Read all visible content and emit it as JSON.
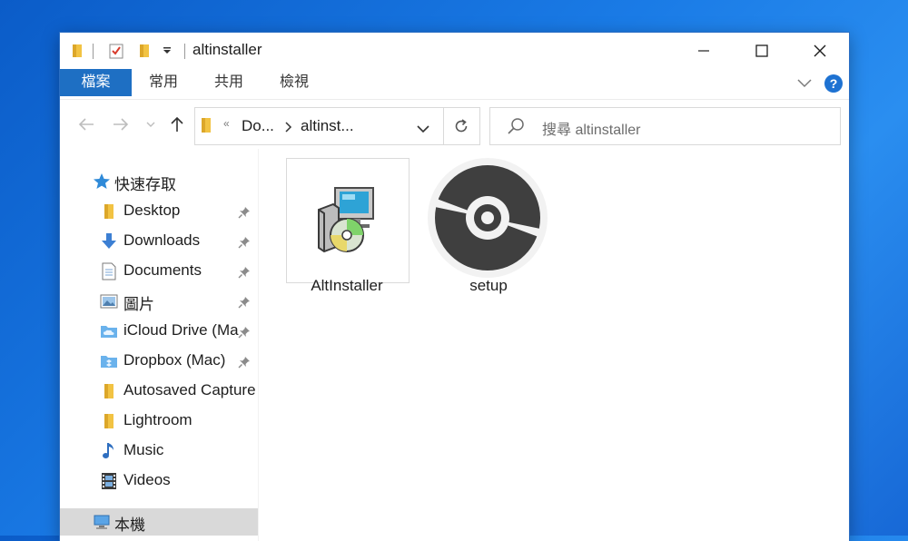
{
  "window": {
    "title": "altinstaller",
    "controls": {
      "minimize": "minimize",
      "maximize": "maximize",
      "close": "close"
    }
  },
  "ribbon": {
    "tabs": [
      {
        "label": "檔案",
        "active": true
      },
      {
        "label": "常用",
        "active": false
      },
      {
        "label": "共用",
        "active": false
      },
      {
        "label": "檢視",
        "active": false
      }
    ],
    "help_label": "?"
  },
  "address_bar": {
    "overflow": "«",
    "crumbs": [
      "Do...",
      "altinst..."
    ],
    "search_placeholder": "搜尋 altinstaller"
  },
  "nav_pane": {
    "quick_access_label": "快速存取",
    "items": [
      {
        "label": "Desktop",
        "icon": "folder-icon",
        "pinned": true
      },
      {
        "label": "Downloads",
        "icon": "download-arrow-icon",
        "pinned": true
      },
      {
        "label": "Documents",
        "icon": "document-icon",
        "pinned": true
      },
      {
        "label": "圖片",
        "icon": "pictures-icon",
        "pinned": true
      },
      {
        "label": "iCloud Drive (Ma",
        "icon": "cloud-folder-icon",
        "pinned": true
      },
      {
        "label": "Dropbox (Mac)",
        "icon": "dropbox-folder-icon",
        "pinned": true
      },
      {
        "label": "Autosaved Capture",
        "icon": "folder-icon",
        "pinned": false
      },
      {
        "label": "Lightroom",
        "icon": "folder-icon",
        "pinned": false
      },
      {
        "label": "Music",
        "icon": "music-note-icon",
        "pinned": false
      },
      {
        "label": "Videos",
        "icon": "film-icon",
        "pinned": false
      }
    ],
    "this_pc_label": "本機"
  },
  "files": [
    {
      "name": "AltInstaller",
      "icon": "installer-icon",
      "selected": true
    },
    {
      "name": "setup",
      "icon": "disc-icon",
      "selected": false
    }
  ],
  "colors": {
    "accent": "#1e6fc3",
    "folder": "#f2c343",
    "desktop_bg": "#1a7be6"
  }
}
